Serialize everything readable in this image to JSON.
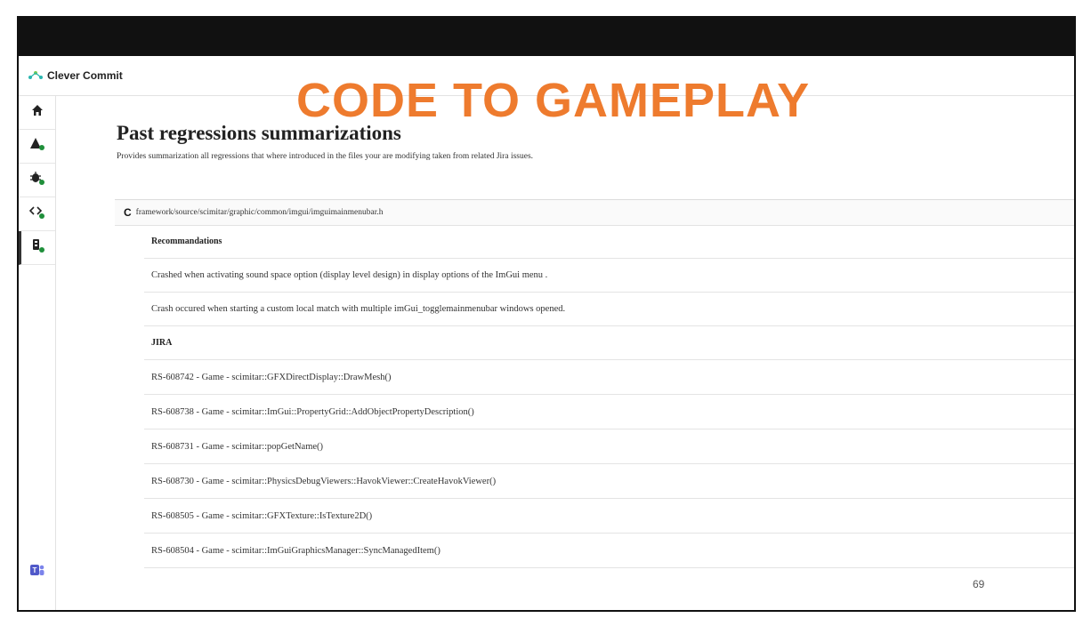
{
  "app": {
    "name": "Clever Commit"
  },
  "banner": {
    "title": "CODE TO GAMEPLAY"
  },
  "sidebar": {
    "items": [
      {
        "icon": "home-icon"
      },
      {
        "icon": "warning-icon"
      },
      {
        "icon": "bug-icon"
      },
      {
        "icon": "code-icon"
      },
      {
        "icon": "regression-icon"
      }
    ],
    "bottom_icon": "teams-icon"
  },
  "page": {
    "title": "Past regressions summarizations",
    "description": "Provides summarization all regressions that where introduced in the files your are modifying taken from related Jira issues."
  },
  "file": {
    "letter": "C",
    "path": "framework/source/scimitar/graphic/common/imgui/imguimainmenubar.h"
  },
  "recommendations": {
    "heading": "Recommandations",
    "items": [
      "Crashed when activating sound space option (display level design) in display options of the ImGui menu .",
      "Crash occured when starting a custom local match with multiple imGui_togglemainmenubar windows opened."
    ]
  },
  "jira": {
    "heading": "JIRA",
    "issues": [
      "RS-608742 - Game - scimitar::GFXDirectDisplay::DrawMesh()",
      "RS-608738 - Game - scimitar::ImGui::PropertyGrid::AddObjectPropertyDescription()",
      "RS-608731 - Game - scimitar::popGetName()",
      "RS-608730 - Game - scimitar::PhysicsDebugViewers::HavokViewer::CreateHavokViewer()",
      "RS-608505 - Game - scimitar::GFXTexture::IsTexture2D()",
      "RS-608504 - Game - scimitar::ImGuiGraphicsManager::SyncManagedItem()"
    ]
  },
  "slide": {
    "page_number": "69"
  },
  "colors": {
    "accent_orange": "#ee7b2e",
    "status_green": "#1f8f3a",
    "brand_teal": "#2bb6b0"
  }
}
